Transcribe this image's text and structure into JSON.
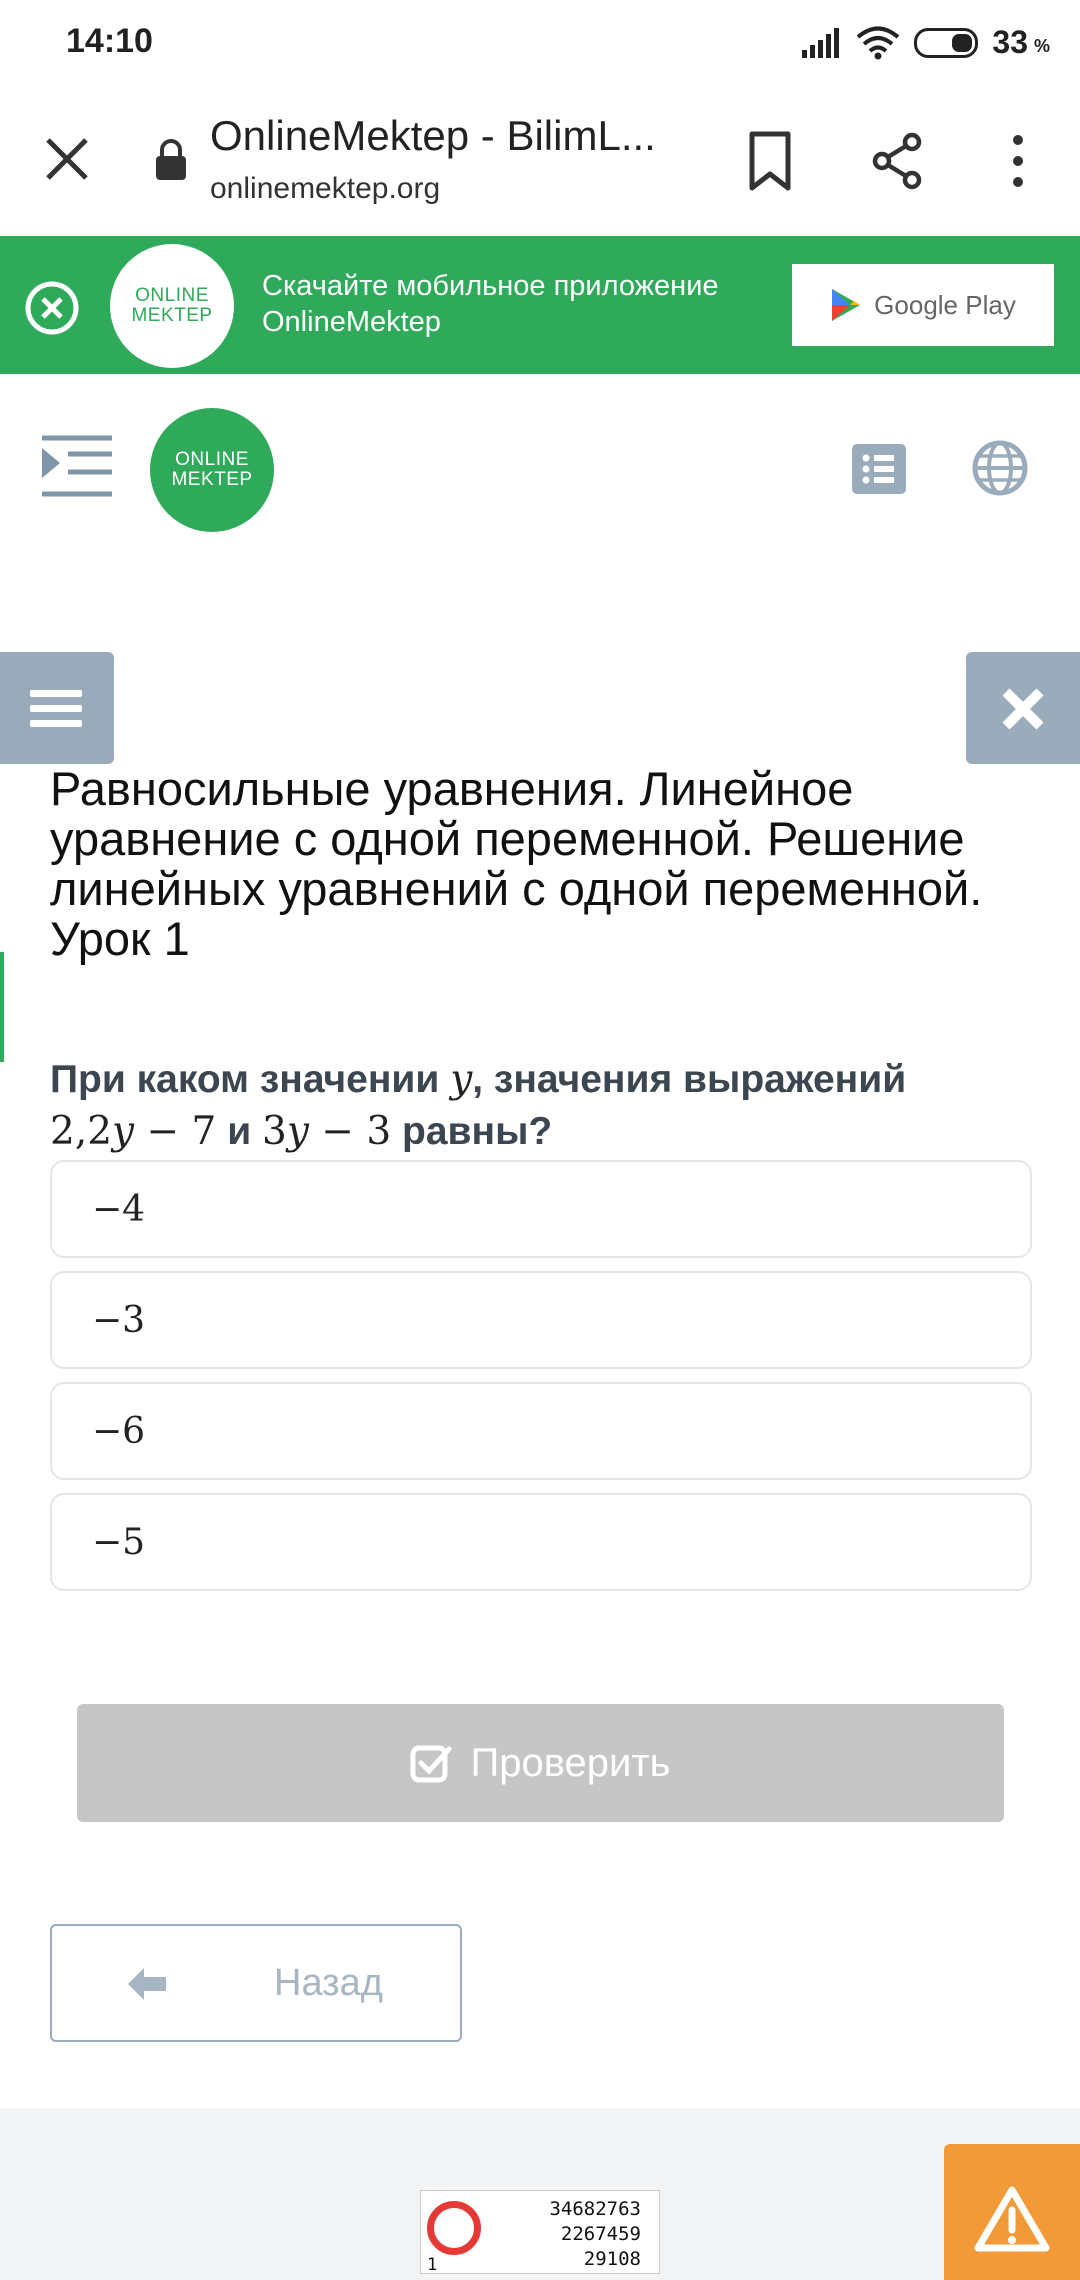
{
  "status_bar": {
    "time": "14:10",
    "battery": "33",
    "battery_unit": "%"
  },
  "browser": {
    "title": "OnlineMektep - BilimL...",
    "url": "onlinemektep.org"
  },
  "banner": {
    "logo_line1": "ONLINE",
    "logo_line2": "MEKTEP",
    "text_line1": "Скачайте мобильное приложение",
    "text_line2": "OnlineMektep",
    "store_label": "Google Play"
  },
  "header": {
    "logo_line1": "ONLINE",
    "logo_line2": "MEKTEP"
  },
  "lesson": {
    "title": "Равносильные уравнения. Линейное уравнение с одной переменной. Решение линейных уравнений с одной переменной. Урок 1"
  },
  "question": {
    "prefix": "При каком значении ",
    "var": "y",
    "middle": ", значения выражений",
    "expr1_num": "2,2",
    "expr1_var": "y",
    "expr1_rest": " − 7",
    "conj": " и ",
    "expr2_num": "3",
    "expr2_var": "y",
    "expr2_rest": " − 3",
    "suffix": " равны?"
  },
  "options": [
    "−4",
    "−3",
    "−6",
    "−5"
  ],
  "actions": {
    "check_label": "Проверить",
    "back_label": "Назад"
  },
  "counter": {
    "line1": "34682763",
    "line2": "2267459",
    "line3": "29108",
    "left_digit": "1"
  },
  "colors": {
    "brand_green": "#2faa5a",
    "slate_button": "#9aabbb",
    "disabled_button": "#c6c6c6",
    "alert_orange": "#f29a38"
  }
}
